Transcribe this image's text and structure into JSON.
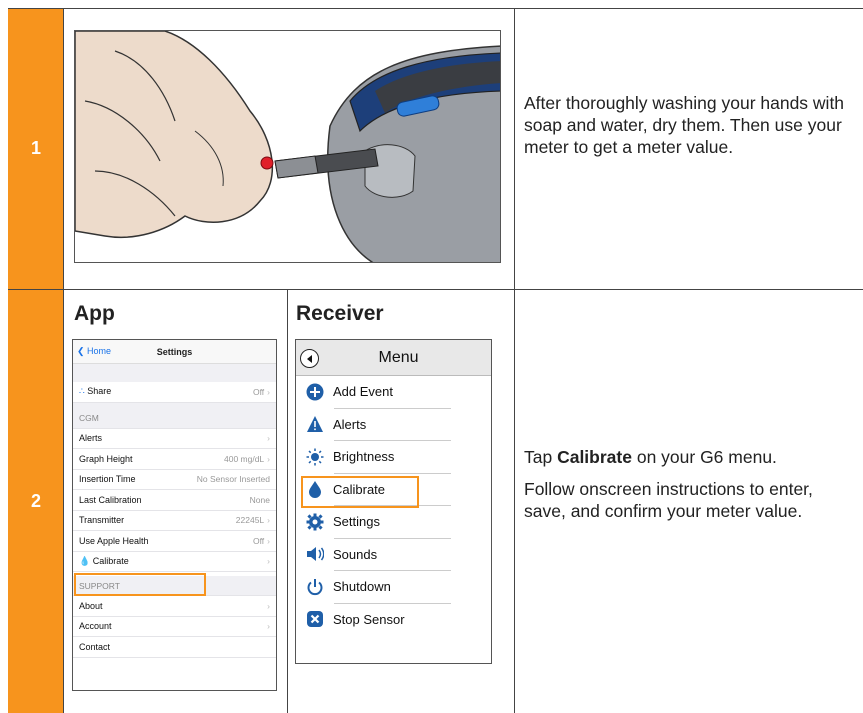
{
  "steps": [
    {
      "number": "1",
      "instruction": "After thoroughly washing your hands with soap and water, dry them. Then use your meter to get a meter value."
    },
    {
      "number": "2",
      "instruction_prefix": "Tap ",
      "instruction_bold": "Calibrate",
      "instruction_suffix": " on your G6 menu.",
      "instruction2": "Follow onscreen instructions to enter, save, and confirm your meter value."
    }
  ],
  "app": {
    "column_title": "App",
    "back_label": "Home",
    "title": "Settings",
    "rows": [
      {
        "label": "Share",
        "value": "Off"
      },
      {
        "section": "CGM"
      },
      {
        "label": "Alerts",
        "value": ""
      },
      {
        "label": "Graph Height",
        "value": "400 mg/dL"
      },
      {
        "label": "Insertion Time",
        "value": "No Sensor Inserted"
      },
      {
        "label": "Last Calibration",
        "value": "None"
      },
      {
        "label": "Transmitter",
        "value": "22245L"
      },
      {
        "label": "Use Apple Health",
        "value": "Off"
      },
      {
        "label": "Calibrate",
        "value": ""
      },
      {
        "section": "SUPPORT"
      },
      {
        "label": "About",
        "value": ""
      },
      {
        "label": "Account",
        "value": ""
      },
      {
        "label": "Contact",
        "value": ""
      }
    ]
  },
  "receiver": {
    "column_title": "Receiver",
    "title": "Menu",
    "items": [
      "Add Event",
      "Alerts",
      "Brightness",
      "Calibrate",
      "Settings",
      "Sounds",
      "Shutdown",
      "Stop Sensor"
    ]
  },
  "colors": {
    "accent": "#f7941d",
    "link": "#1a73e8",
    "menu_blue": "#1f5fa8"
  }
}
